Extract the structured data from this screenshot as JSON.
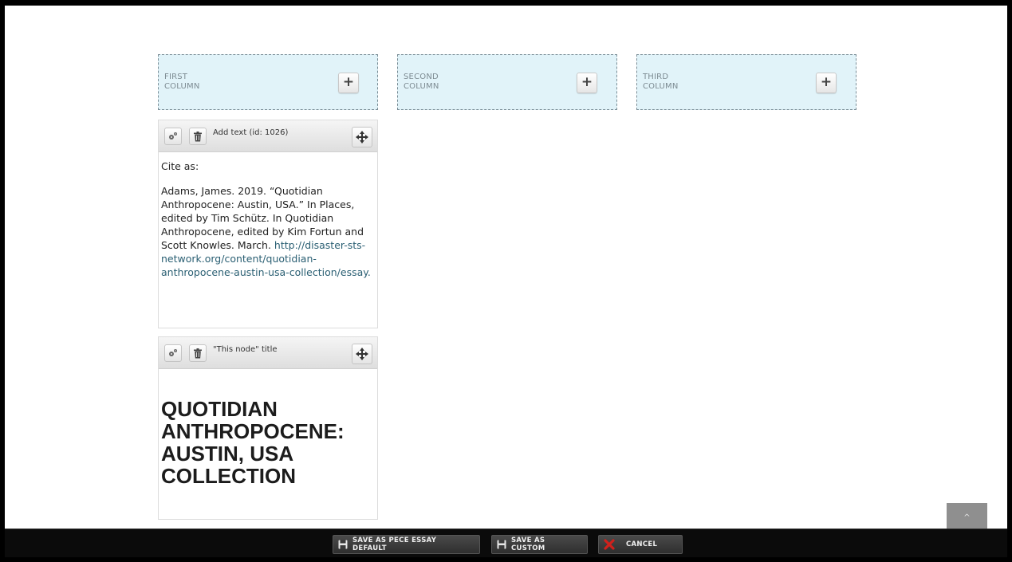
{
  "columns": [
    {
      "label_line1": "FIRST",
      "label_line2": "COLUMN",
      "add_label": "+"
    },
    {
      "label_line1": "SECOND",
      "label_line2": "COLUMN",
      "add_label": "+"
    },
    {
      "label_line1": "THIRD",
      "label_line2": "COLUMN",
      "add_label": "+"
    }
  ],
  "panes": {
    "text": {
      "title": "Add text (id: 1026)",
      "cite_label": "Cite as:",
      "citation": "Adams, James. 2019. “Quotidian Anthropocene: Austin, USA.” In Places, edited by Tim Schütz. In Quotidian Anthropocene, edited by Kim Fortun and Scott Knowles. March. ",
      "link_text": "http://disaster-sts-network.org/content/quotidian-anthropocene-austin-usa-collection/essay."
    },
    "node_title": {
      "title": "\"This node\" title",
      "heading": "QUOTIDIAN ANTHROPOCENE: AUSTIN, USA COLLECTION"
    }
  },
  "toolbar": {
    "save_default_label": "SAVE AS PECE ESSAY DEFAULT",
    "save_custom_label": "SAVE AS CUSTOM",
    "cancel_label": "CANCEL"
  },
  "scroll_top_label": "^",
  "colors": {
    "zone_bg": "#e1f3f9",
    "link": "#2a5f73",
    "cancel_icon": "#d0211c"
  },
  "icons": {
    "add": "plus-icon",
    "settings": "gears-icon",
    "delete": "trash-icon",
    "move": "move-arrows-icon",
    "save": "floppy-disk-icon",
    "cancel": "red-x-icon"
  }
}
